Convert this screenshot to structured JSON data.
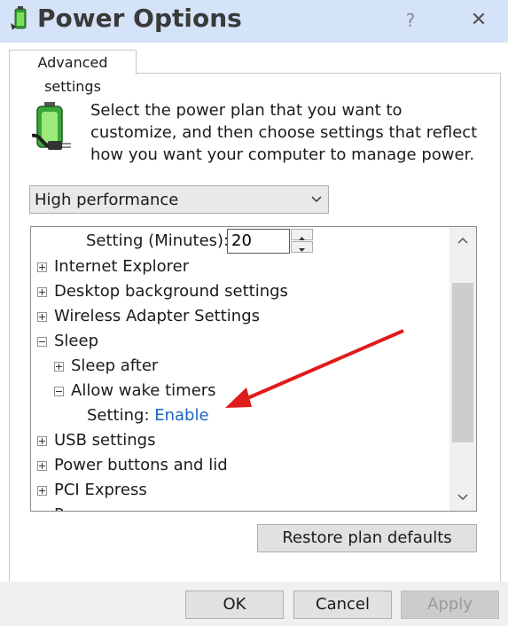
{
  "window": {
    "title": "Power Options",
    "help_glyph": "?",
    "close_glyph": "✕"
  },
  "tab": {
    "label": "Advanced settings"
  },
  "intro": {
    "text": "Select the power plan that you want to customize, and then choose settings that reflect how you want your computer to manage power."
  },
  "plan_select": {
    "value": "High performance"
  },
  "tree": {
    "setting_minutes_label": "Setting (Minutes):",
    "setting_minutes_value": "20",
    "items": [
      {
        "label": "Internet Explorer",
        "state": "collapsed"
      },
      {
        "label": "Desktop background settings",
        "state": "collapsed"
      },
      {
        "label": "Wireless Adapter Settings",
        "state": "collapsed"
      },
      {
        "label": "Sleep",
        "state": "expanded"
      },
      {
        "label": "Sleep after",
        "state": "collapsed"
      },
      {
        "label": "Allow wake timers",
        "state": "expanded"
      },
      {
        "label": "USB settings",
        "state": "collapsed"
      },
      {
        "label": "Power buttons and lid",
        "state": "collapsed"
      },
      {
        "label": "PCI Express",
        "state": "collapsed"
      },
      {
        "label": "P",
        "state": "collapsed"
      }
    ],
    "wake_setting_label": "Setting:",
    "wake_setting_value": "Enable"
  },
  "buttons": {
    "restore": "Restore plan defaults",
    "ok": "OK",
    "cancel": "Cancel",
    "apply": "Apply"
  },
  "colors": {
    "titlebar": "#d4e3f8",
    "link": "#1a66c2",
    "annotation_arrow": "#e01b1b"
  }
}
